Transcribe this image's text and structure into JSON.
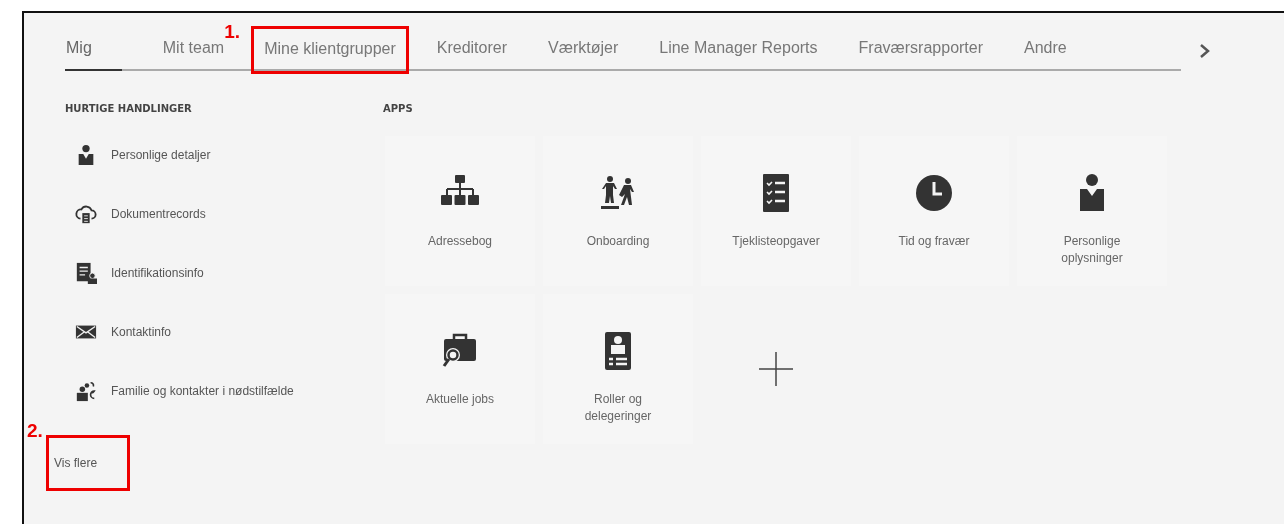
{
  "tabs": [
    {
      "label": "Mig",
      "selected": true
    },
    {
      "label": "Mit team",
      "selected": false
    },
    {
      "label": "Mine klientgrupper",
      "selected": false,
      "callout": "1."
    },
    {
      "label": "Kreditorer",
      "selected": false
    },
    {
      "label": "Værktøjer",
      "selected": false
    },
    {
      "label": "Line Manager Reports",
      "selected": false
    },
    {
      "label": "Fraværsrapporter",
      "selected": false
    },
    {
      "label": "Andre",
      "selected": false
    }
  ],
  "quick_actions": {
    "title": "HURTIGE HANDLINGER",
    "items": [
      {
        "label": "Personlige detaljer"
      },
      {
        "label": "Dokumentrecords"
      },
      {
        "label": "Identifikationsinfo"
      },
      {
        "label": "Kontaktinfo"
      },
      {
        "label": "Familie og kontakter i nødstilfælde"
      }
    ],
    "show_more": {
      "label": "Vis flere",
      "callout": "2."
    }
  },
  "apps": {
    "title": "APPS",
    "items": [
      {
        "kind": "app",
        "label": "Adressebog"
      },
      {
        "kind": "app",
        "label": "Onboarding"
      },
      {
        "kind": "app",
        "label": "Tjeklisteopgaver"
      },
      {
        "kind": "app",
        "label": "Tid og fravær"
      },
      {
        "kind": "app",
        "label": "Personlige oplysninger"
      },
      {
        "kind": "app",
        "label": "Aktuelle jobs"
      },
      {
        "kind": "app",
        "label": "Roller og delegeringer"
      },
      {
        "kind": "add"
      }
    ]
  }
}
